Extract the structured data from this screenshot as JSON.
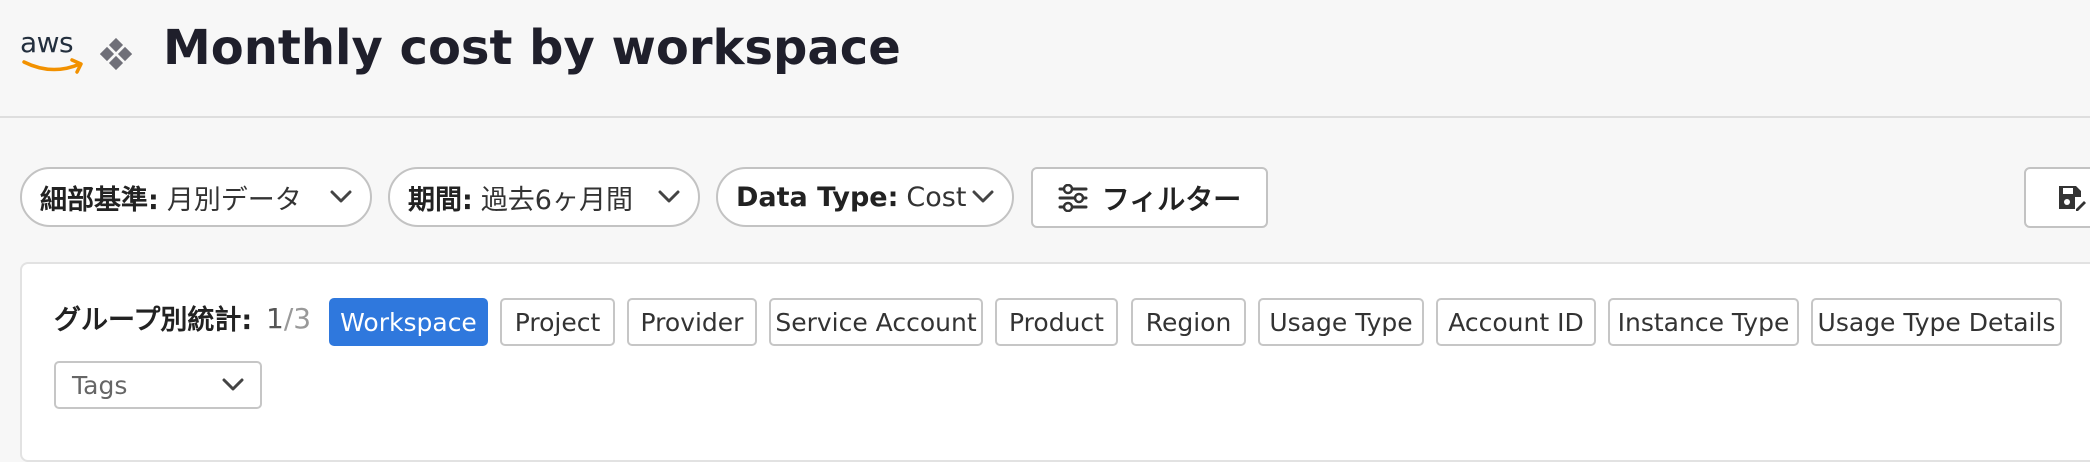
{
  "header": {
    "logo_text": "aws",
    "title": "Monthly cost by workspace"
  },
  "toolbar": {
    "granularity": {
      "label": "細部基準:",
      "value": "月別データ"
    },
    "period": {
      "label": "期間:",
      "value": "過去6ヶ月間"
    },
    "data_type": {
      "label": "Data Type:",
      "value": "Cost"
    },
    "filter_label": "フィルター"
  },
  "group_by": {
    "label": "グループ別統計:",
    "count_current": "1",
    "count_sep": "/",
    "count_max": "3",
    "options": [
      {
        "label": "Workspace",
        "active": true
      },
      {
        "label": "Project",
        "active": false
      },
      {
        "label": "Provider",
        "active": false
      },
      {
        "label": "Service Account",
        "active": false
      },
      {
        "label": "Product",
        "active": false
      },
      {
        "label": "Region",
        "active": false
      },
      {
        "label": "Usage Type",
        "active": false
      },
      {
        "label": "Account ID",
        "active": false
      },
      {
        "label": "Instance Type",
        "active": false
      },
      {
        "label": "Usage Type Details",
        "active": false
      }
    ],
    "tags_placeholder": "Tags"
  },
  "colors": {
    "accent": "#2f78dd",
    "aws_orange": "#f29100",
    "title": "#1f1f2b"
  }
}
